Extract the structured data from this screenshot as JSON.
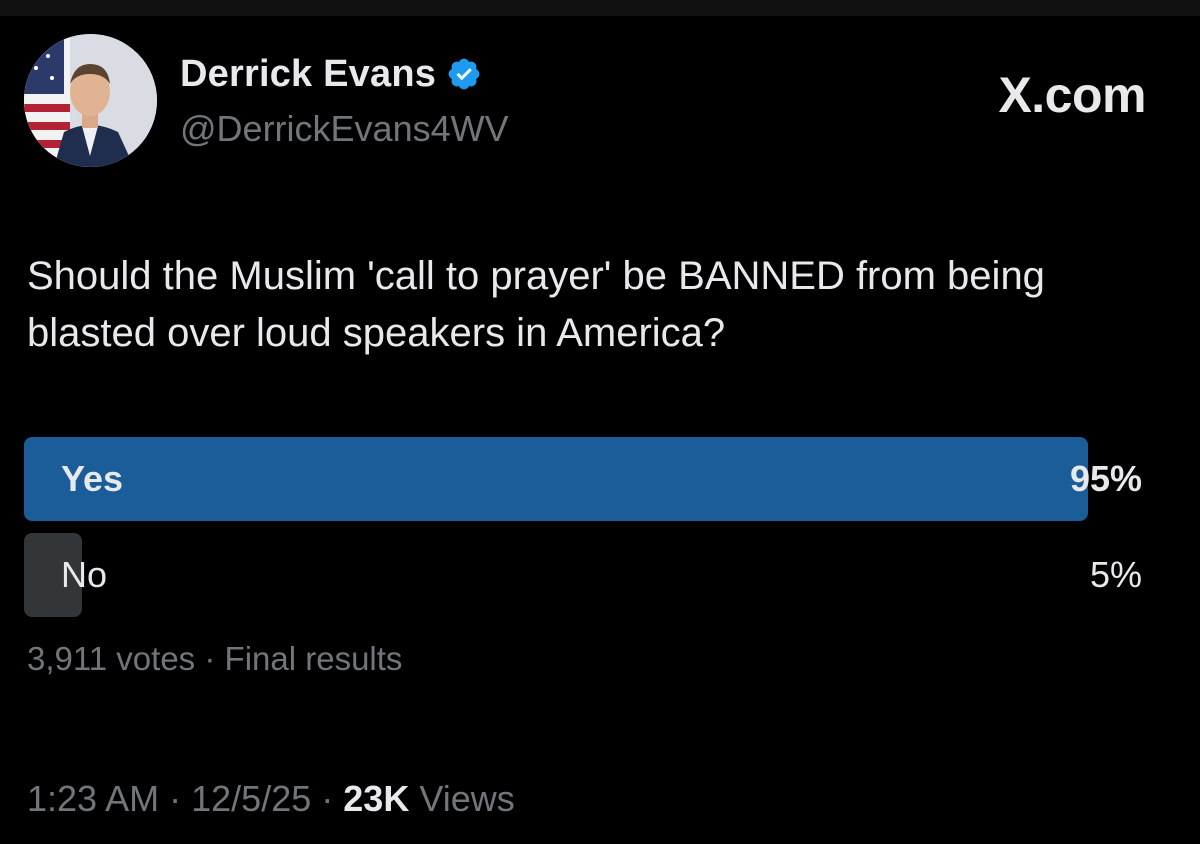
{
  "author": {
    "name": "Derrick Evans",
    "handle": "@DerrickEvans4WV",
    "verified": true,
    "avatar_icon": "profile-photo"
  },
  "brand": "X.com",
  "post": {
    "text": "Should the Muslim 'call to prayer' be BANNED from being blasted over loud speakers in America?"
  },
  "poll": {
    "options": [
      {
        "label": "Yes",
        "percent_text": "95%",
        "percent": 95
      },
      {
        "label": "No",
        "percent_text": "5%",
        "percent": 5
      }
    ],
    "votes": "3,911 votes",
    "separator": "·",
    "status": "Final results"
  },
  "footer": {
    "time": "1:23 AM",
    "separator": "·",
    "date": "12/5/25",
    "views_count": "23K",
    "views_label": "Views"
  },
  "colors": {
    "background": "#000000",
    "text": "#e7e9ea",
    "muted": "#71767b",
    "poll_winner": "#1a5d99",
    "poll_other": "#333639",
    "verified_blue": "#1d9bf0"
  }
}
